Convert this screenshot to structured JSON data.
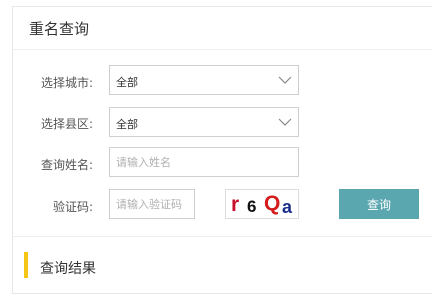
{
  "panel": {
    "title": "重名查询"
  },
  "form": {
    "city": {
      "label": "选择城市:",
      "value": "全部"
    },
    "county": {
      "label": "选择县区:",
      "value": "全部"
    },
    "name": {
      "label": "查询姓名:",
      "placeholder": "请输入姓名",
      "value": ""
    },
    "captcha": {
      "label": "验证码:",
      "placeholder": "请输入验证码",
      "value": ""
    },
    "captcha_image": {
      "chars": [
        "r",
        "6",
        "Q",
        "a"
      ],
      "colors": [
        "#c8102e",
        "#111111",
        "#d41c1c",
        "#1b2f8a"
      ]
    },
    "submit_label": "查询"
  },
  "results": {
    "title": "查询结果"
  },
  "colors": {
    "accent": "#5aa7af",
    "result_bar": "#f5c518"
  }
}
